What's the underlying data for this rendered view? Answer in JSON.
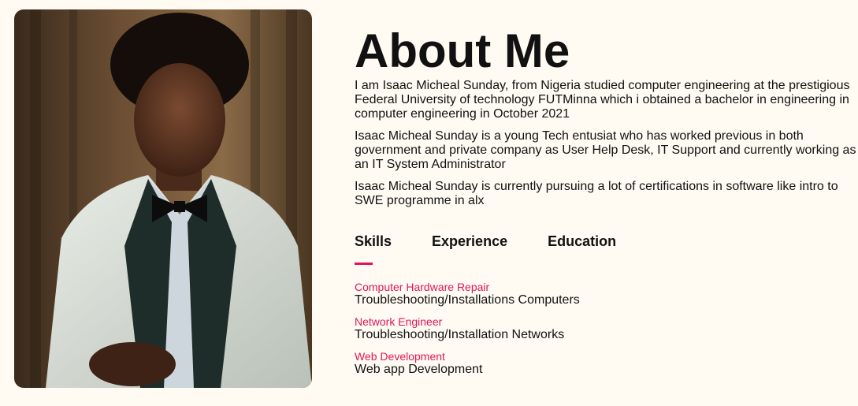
{
  "about": {
    "title": "About Me",
    "paragraphs": [
      "I am Isaac Micheal Sunday, from Nigeria studied computer engineering at the prestigious Federal University of technology FUTMinna which i obtained a bachelor in engineering in computer engineering in October 2021",
      "Isaac Micheal Sunday is a young Tech entusiat who has worked previous in both government and private company as User Help Desk, IT Support and currently working as an IT System Administrator",
      "Isaac Micheal Sunday is currently pursuing a lot of certifications in software like intro to SWE programme in alx"
    ]
  },
  "tabs": [
    {
      "label": "Skills",
      "active": true
    },
    {
      "label": "Experience",
      "active": false
    },
    {
      "label": "Education",
      "active": false
    }
  ],
  "skills": [
    {
      "title": "Computer Hardware Repair",
      "desc": "Troubleshooting/Installations Computers"
    },
    {
      "title": "Network Engineer",
      "desc": "Troubleshooting/Installation Networks"
    },
    {
      "title": "Web Development",
      "desc": "Web app Development"
    }
  ],
  "colors": {
    "accent": "#e0155a",
    "background": "#fffbf3",
    "text": "#111111"
  },
  "photo": {
    "icon": "profile-photo"
  }
}
